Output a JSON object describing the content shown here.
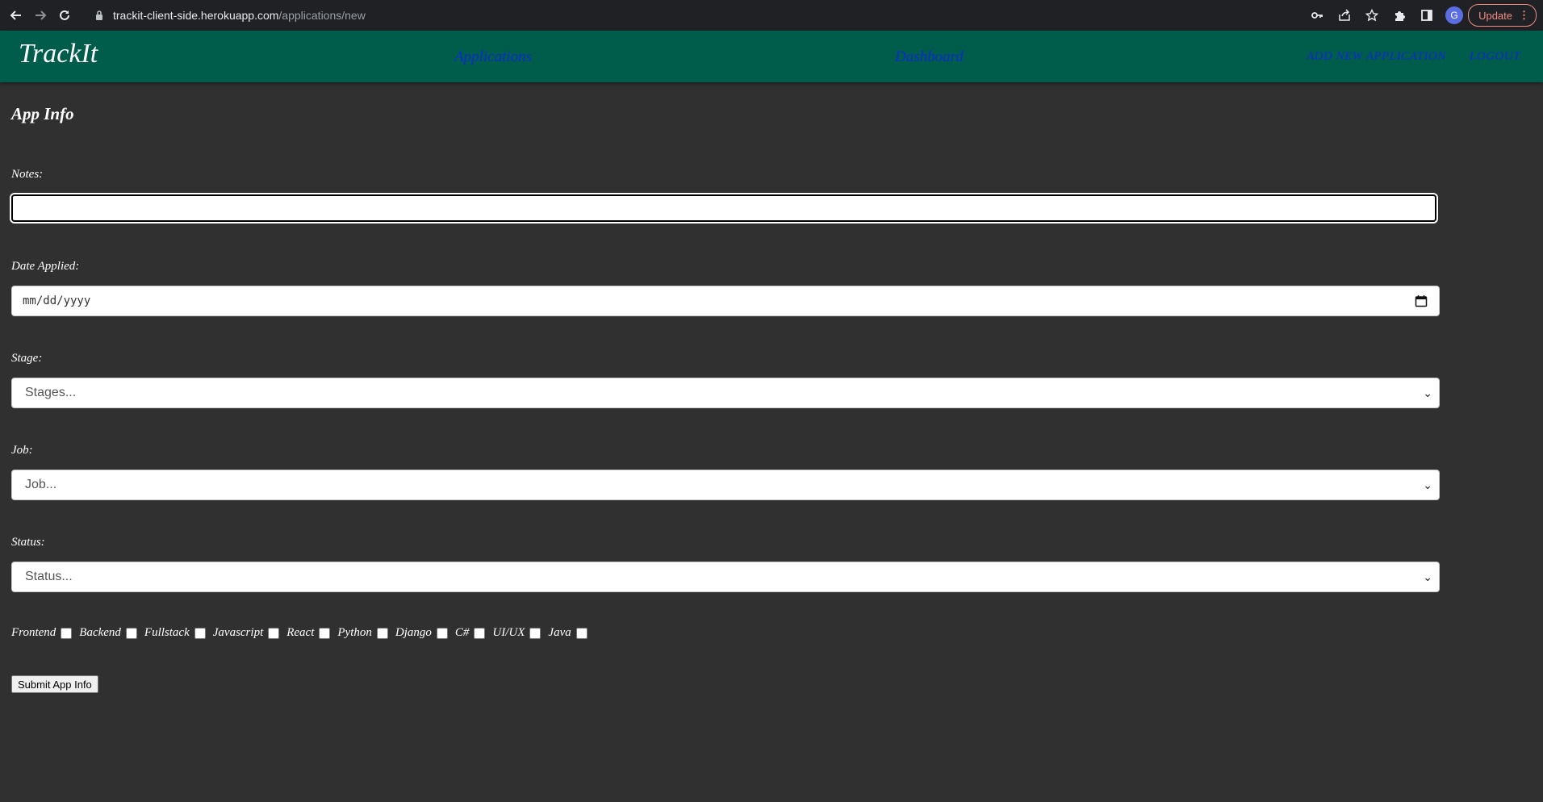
{
  "browser": {
    "url_host": "trackit-client-side.herokuapp.com",
    "url_path": "/applications/new",
    "profile_initial": "G",
    "update_label": "Update"
  },
  "navbar": {
    "brand": "TrackIt",
    "links": [
      "Applications",
      "Dashboard",
      "ADD NEW APPLICATION",
      "LOGOUT"
    ]
  },
  "form": {
    "title": "App Info",
    "notes_label": "Notes:",
    "notes_value": "",
    "date_label": "Date Applied:",
    "date_placeholder": "mm/dd/yyyy",
    "stage_label": "Stage:",
    "stage_value": "Stages...",
    "job_label": "Job:",
    "job_value": "Job...",
    "status_label": "Status:",
    "status_value": "Status...",
    "tags": [
      "Frontend",
      "Backend",
      "Fullstack",
      "Javascript",
      "React",
      "Python",
      "Django",
      "C#",
      "UI/UX",
      "Java"
    ],
    "submit_label": "Submit App Info"
  }
}
